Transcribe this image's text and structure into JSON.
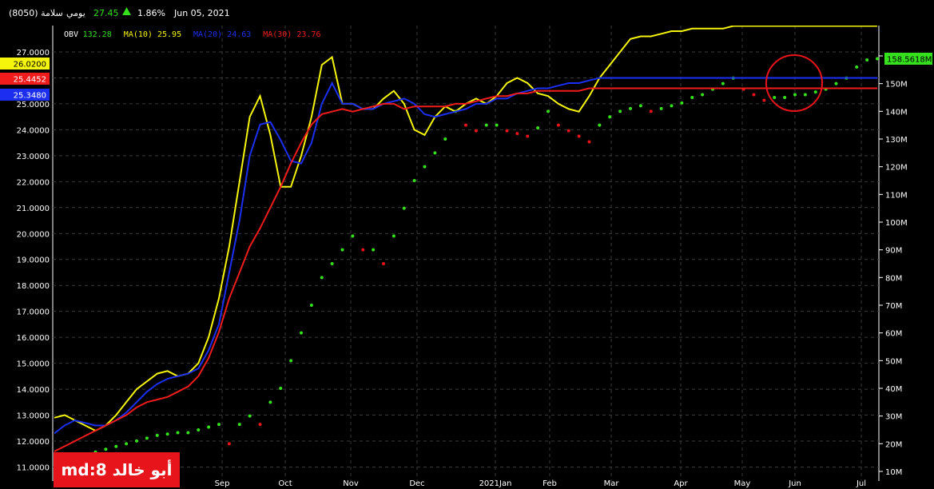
{
  "header": {
    "symbol": "سلامة (8050)",
    "period": "يومي",
    "price": "27.45",
    "change_pct": "1.86%",
    "date": "Jun 05, 2021",
    "up_color": "#35e01c",
    "arrow_icon": "triangle-up-icon"
  },
  "legend": [
    {
      "label": "OBV",
      "value": "132.28",
      "color": "#35e01c"
    },
    {
      "label": "MA(10)",
      "value": "25.95",
      "color": "#f5f50c"
    },
    {
      "label": "MA(20)",
      "value": "24.63",
      "color": "#1c2ff0"
    },
    {
      "label": "MA(30)",
      "value": "23.76",
      "color": "#f01c1c"
    }
  ],
  "left_badges": [
    {
      "text": "26.0200",
      "bg": "#f5f50c",
      "fg": "#000000"
    },
    {
      "text": "25.4452",
      "bg": "#f01c1c",
      "fg": "#ffffff"
    },
    {
      "text": "25.3480",
      "bg": "#1c2ff0",
      "fg": "#ffffff"
    }
  ],
  "right_badge": {
    "text": "158.5618M",
    "bg": "#35e01c",
    "fg": "#000000"
  },
  "watermark": "أبو خالد md:8",
  "chart_data": {
    "type": "line",
    "left_axis": {
      "ticks": [
        "11.0000",
        "12.0000",
        "13.0000",
        "14.0000",
        "15.0000",
        "16.0000",
        "17.0000",
        "18.0000",
        "19.0000",
        "20.0000",
        "21.0000",
        "22.0000",
        "23.0000",
        "24.0000",
        "25.0000",
        "26.0000",
        "27.0000"
      ],
      "range": [
        10.8,
        27.5
      ]
    },
    "right_axis": {
      "ticks": [
        "10M",
        "20M",
        "30M",
        "40M",
        "50M",
        "60M",
        "70M",
        "80M",
        "90M",
        "100M",
        "110M",
        "120M",
        "130M",
        "140M",
        "150M",
        "160M"
      ],
      "range": [
        10,
        162
      ]
    },
    "x_labels": [
      "Sep",
      "Oct",
      "Nov",
      "Dec",
      "2021Jan",
      "Feb",
      "Mar",
      "Apr",
      "May",
      "Jun",
      "Jul"
    ],
    "x": [
      0,
      0.5,
      1,
      1.5,
      2,
      2.5,
      3,
      3.5,
      4,
      4.5,
      5,
      5.5,
      6,
      6.5,
      7,
      7.5,
      8,
      8.5,
      9,
      9.5,
      10,
      10.5,
      11,
      11.5,
      12,
      12.5,
      13,
      13.5,
      14,
      14.5,
      15,
      15.5,
      16,
      16.5,
      17,
      17.5,
      18,
      18.5,
      19,
      19.5,
      20,
      20.5,
      21,
      21.5,
      22,
      22.5,
      23,
      23.5,
      24,
      24.5,
      25,
      25.5,
      26,
      26.5,
      27,
      27.5,
      28,
      28.5,
      29,
      29.5,
      30,
      30.5,
      31,
      31.5,
      32,
      32.5,
      33,
      33.5,
      34,
      34.5,
      35,
      35.5,
      36,
      36.5,
      37,
      37.5,
      38,
      38.5,
      39,
      39.5,
      40
    ],
    "series": [
      {
        "name": "OBV",
        "axis": "right",
        "style": "dotted",
        "values": [
          13,
          14,
          15,
          16,
          17,
          18,
          19,
          20,
          21,
          22,
          23,
          23.5,
          24,
          24,
          25,
          26,
          27,
          20,
          27,
          30,
          27,
          35,
          40,
          50,
          60,
          70,
          80,
          85,
          90,
          95,
          90,
          90,
          85,
          95,
          105,
          115,
          120,
          125,
          130,
          140,
          135,
          133,
          135,
          135,
          133,
          132,
          131,
          134,
          140,
          135,
          133,
          131,
          129,
          135,
          138,
          140,
          141,
          142,
          140,
          141,
          142,
          143,
          145,
          146,
          148,
          150,
          152,
          148,
          146,
          144,
          145,
          145,
          146,
          146,
          147,
          148,
          150,
          152,
          156,
          158.56,
          159
        ]
      },
      {
        "name": "MA(10)",
        "axis": "left",
        "values": [
          12.9,
          13.0,
          12.8,
          12.6,
          12.4,
          12.6,
          13.0,
          13.5,
          14.0,
          14.3,
          14.6,
          14.7,
          14.5,
          14.6,
          15.0,
          16.0,
          17.5,
          19.5,
          22.0,
          24.5,
          25.3,
          23.8,
          21.8,
          21.8,
          23.0,
          24.5,
          26.5,
          26.8,
          25.0,
          25.0,
          24.8,
          24.8,
          25.2,
          25.5,
          25.0,
          24.0,
          23.8,
          24.5,
          24.9,
          24.7,
          25.0,
          25.2,
          25.0,
          25.3,
          25.8,
          26.0,
          25.8,
          25.4,
          25.3,
          25.0,
          24.8,
          24.7,
          25.3,
          26.0,
          26.5,
          27.0,
          27.5,
          27.6,
          27.6,
          27.7,
          27.8,
          27.8,
          27.9,
          27.9,
          27.9,
          27.9,
          28.0,
          28.0,
          28.0,
          28.0,
          28.0,
          28.0,
          28.0,
          28.0,
          28.0,
          28.0,
          28.0,
          28.0,
          28.0,
          28.0,
          28.0
        ]
      },
      {
        "name": "MA(20)",
        "axis": "left",
        "values": [
          12.3,
          12.6,
          12.8,
          12.7,
          12.6,
          12.6,
          12.8,
          13.1,
          13.5,
          13.9,
          14.2,
          14.4,
          14.5,
          14.6,
          14.8,
          15.5,
          16.5,
          18.5,
          20.5,
          23.0,
          24.2,
          24.3,
          23.6,
          22.8,
          22.7,
          23.5,
          25.0,
          25.8,
          25.0,
          25.0,
          24.8,
          24.8,
          25.0,
          25.1,
          25.2,
          25.0,
          24.6,
          24.5,
          24.6,
          24.7,
          24.8,
          25.0,
          25.0,
          25.2,
          25.2,
          25.4,
          25.5,
          25.6,
          25.6,
          25.7,
          25.8,
          25.8,
          25.9,
          26.0,
          26.0,
          26.0,
          26.0,
          26.0,
          26.0,
          26.0,
          26.0,
          26.0,
          26.0,
          26.0,
          26.0,
          26.0,
          26.0,
          26.0,
          26.0,
          26.0,
          26.0,
          26.0,
          26.0,
          26.0,
          26.0,
          26.0,
          26.0,
          26.0,
          26.0,
          26.0,
          26.0
        ]
      },
      {
        "name": "MA(30)",
        "axis": "left",
        "values": [
          11.6,
          11.8,
          12.0,
          12.2,
          12.4,
          12.6,
          12.8,
          13.0,
          13.3,
          13.5,
          13.6,
          13.7,
          13.9,
          14.1,
          14.5,
          15.2,
          16.2,
          17.5,
          18.5,
          19.5,
          20.2,
          21.0,
          21.8,
          22.7,
          23.5,
          24.2,
          24.6,
          24.7,
          24.8,
          24.7,
          24.8,
          24.9,
          25.0,
          25.0,
          24.8,
          24.9,
          24.9,
          24.9,
          24.9,
          25.0,
          25.0,
          25.1,
          25.2,
          25.3,
          25.3,
          25.4,
          25.4,
          25.5,
          25.5,
          25.5,
          25.5,
          25.5,
          25.6,
          25.6,
          25.6,
          25.6,
          25.6,
          25.6,
          25.6,
          25.6,
          25.6,
          25.6,
          25.6,
          25.6,
          25.6,
          25.6,
          25.6,
          25.6,
          25.6,
          25.6,
          25.6,
          25.6,
          25.6,
          25.6,
          25.6,
          25.6,
          25.6,
          25.6,
          25.6,
          25.6,
          25.6
        ]
      }
    ],
    "grid": true,
    "annotation": "red circle around latest OBV / MA values"
  }
}
